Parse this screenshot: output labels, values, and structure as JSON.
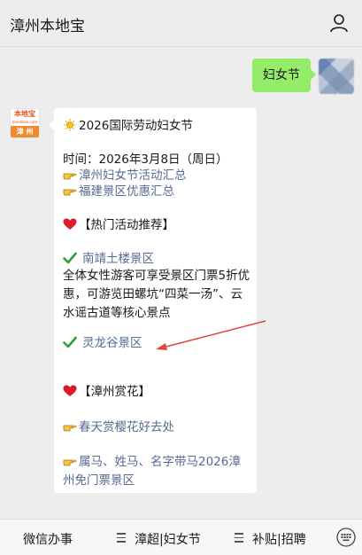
{
  "header": {
    "title": "漳州本地宝",
    "profile_icon": "person-icon"
  },
  "conversation": {
    "user_message": "妇女节",
    "bot_avatar": {
      "top_text": "本地宝",
      "sub_text": "bendibao.com",
      "bottom_text": "漳 州"
    },
    "reply": {
      "title": "2026国际劳动妇女节",
      "date_line": "时间：2026年3月8日（周日）",
      "link1": "漳州妇女节活动汇总",
      "link2": "福建景区优惠汇总",
      "hot_section": "【热门活动推荐】",
      "spot1": "南靖土楼景区",
      "spot1_desc": "全体女性游客可享受景区门票5折优惠，可游览田螺坑“四菜一汤”、云水谣古道等核心景点",
      "spot2": "灵龙谷景区",
      "flower_section": "【漳州赏花】",
      "link3": "春天赏樱花好去处",
      "link4": "属马、姓马、名字带马2026漳州免门票景区"
    }
  },
  "footer": {
    "item1": "微信办事",
    "item2": "漳超|妇女节",
    "item3": "补贴|招聘"
  },
  "colors": {
    "bubble": "#95ec69",
    "link": "#576b95",
    "background": "#ededed"
  }
}
